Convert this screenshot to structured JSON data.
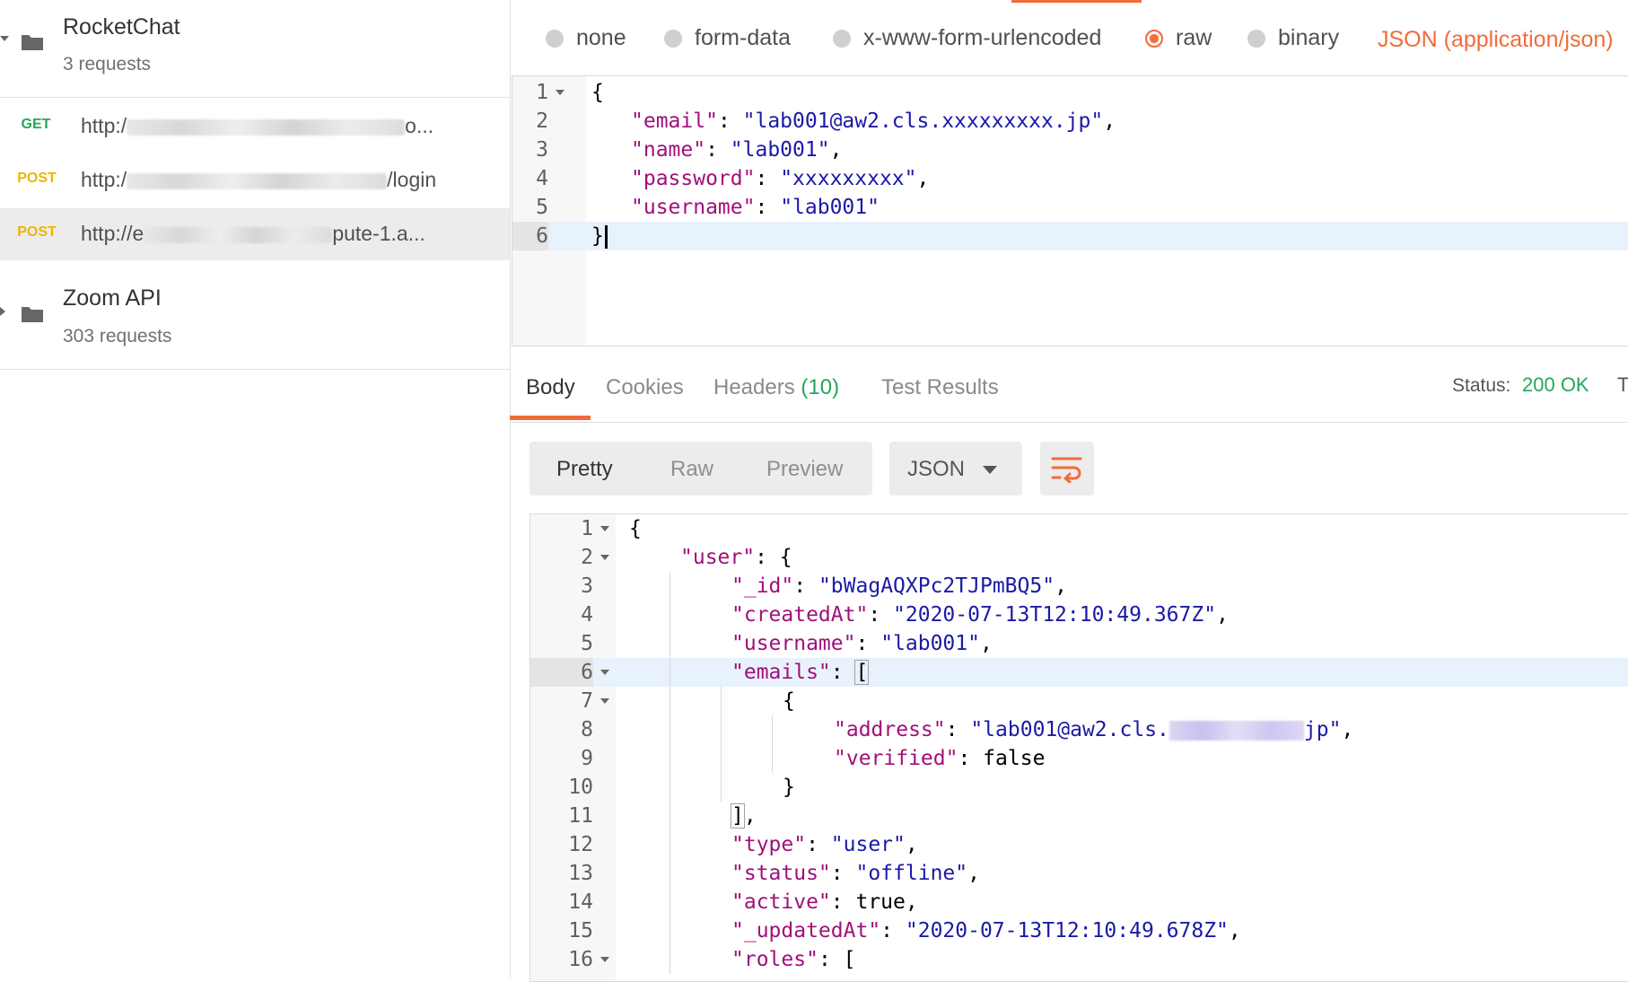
{
  "sidebar": {
    "collections": [
      {
        "name": "RocketChat",
        "count": "3 requests",
        "requests": [
          {
            "method": "GET",
            "url_start": "http:/",
            "url_end": "o..."
          },
          {
            "method": "POST",
            "url_start": "http:/",
            "url_end": "/login"
          },
          {
            "method": "POST",
            "url_start": "http://e",
            "url_end": "pute-1.a..."
          }
        ]
      },
      {
        "name": "Zoom API",
        "count": "303 requests"
      }
    ]
  },
  "body_types": {
    "options": [
      "none",
      "form-data",
      "x-www-form-urlencoded",
      "raw",
      "binary"
    ],
    "selected": "raw",
    "content_type": "JSON (application/json)"
  },
  "request_body": {
    "line_numbers": [
      "1",
      "2",
      "3",
      "4",
      "5",
      "6"
    ],
    "lines": [
      [
        {
          "t": "p",
          "v": "{"
        }
      ],
      [
        {
          "t": "k",
          "v": "\"email\""
        },
        {
          "t": "p",
          "v": ": "
        },
        {
          "t": "s",
          "v": "\"lab001@aw2.cls.xxxxxxxxx.jp\""
        },
        {
          "t": "p",
          "v": ","
        }
      ],
      [
        {
          "t": "k",
          "v": "\"name\""
        },
        {
          "t": "p",
          "v": ": "
        },
        {
          "t": "s",
          "v": "\"lab001\""
        },
        {
          "t": "p",
          "v": ","
        }
      ],
      [
        {
          "t": "k",
          "v": "\"password\""
        },
        {
          "t": "p",
          "v": ": "
        },
        {
          "t": "s",
          "v": "\"xxxxxxxxx\""
        },
        {
          "t": "p",
          "v": ","
        }
      ],
      [
        {
          "t": "k",
          "v": "\"username\""
        },
        {
          "t": "p",
          "v": ": "
        },
        {
          "t": "s",
          "v": "\"lab001\""
        }
      ],
      [
        {
          "t": "p",
          "v": "}"
        }
      ]
    ]
  },
  "response_tabs": {
    "body": "Body",
    "cookies": "Cookies",
    "headers": "Headers",
    "headers_count": "(10)",
    "test_results": "Test Results"
  },
  "status": {
    "label": "Status:",
    "value": "200 OK",
    "extra": "T"
  },
  "view_modes": {
    "pretty": "Pretty",
    "raw": "Raw",
    "preview": "Preview",
    "format": "JSON"
  },
  "response_body": {
    "line_numbers": [
      "1",
      "2",
      "3",
      "4",
      "5",
      "6",
      "7",
      "8",
      "9",
      "10",
      "11",
      "12",
      "13",
      "14",
      "15",
      "16"
    ],
    "lines": [
      [
        {
          "t": "p",
          "v": "{"
        }
      ],
      [
        {
          "t": "k",
          "v": "\"user\""
        },
        {
          "t": "p",
          "v": ": {"
        }
      ],
      [
        {
          "t": "k",
          "v": "\"_id\""
        },
        {
          "t": "p",
          "v": ": "
        },
        {
          "t": "s",
          "v": "\"bWagAQXPc2TJPmBQ5\""
        },
        {
          "t": "p",
          "v": ","
        }
      ],
      [
        {
          "t": "k",
          "v": "\"createdAt\""
        },
        {
          "t": "p",
          "v": ": "
        },
        {
          "t": "s",
          "v": "\"2020-07-13T12:10:49.367Z\""
        },
        {
          "t": "p",
          "v": ","
        }
      ],
      [
        {
          "t": "k",
          "v": "\"username\""
        },
        {
          "t": "p",
          "v": ": "
        },
        {
          "t": "s",
          "v": "\"lab001\""
        },
        {
          "t": "p",
          "v": ","
        }
      ],
      [
        {
          "t": "k",
          "v": "\"emails\""
        },
        {
          "t": "p",
          "v": ": "
        },
        {
          "t": "b",
          "v": "["
        }
      ],
      [
        {
          "t": "p",
          "v": "{"
        }
      ],
      [
        {
          "t": "k",
          "v": "\"address\""
        },
        {
          "t": "p",
          "v": ": "
        },
        {
          "t": "s",
          "v": "\"lab001@aw2.cls."
        },
        {
          "t": "r",
          "v": ""
        },
        {
          "t": "s",
          "v": "jp\""
        },
        {
          "t": "p",
          "v": ","
        }
      ],
      [
        {
          "t": "k",
          "v": "\"verified\""
        },
        {
          "t": "p",
          "v": ": false"
        }
      ],
      [
        {
          "t": "p",
          "v": "}"
        }
      ],
      [
        {
          "t": "b",
          "v": "]"
        },
        {
          "t": "p",
          "v": ","
        }
      ],
      [
        {
          "t": "k",
          "v": "\"type\""
        },
        {
          "t": "p",
          "v": ": "
        },
        {
          "t": "s",
          "v": "\"user\""
        },
        {
          "t": "p",
          "v": ","
        }
      ],
      [
        {
          "t": "k",
          "v": "\"status\""
        },
        {
          "t": "p",
          "v": ": "
        },
        {
          "t": "s",
          "v": "\"offline\""
        },
        {
          "t": "p",
          "v": ","
        }
      ],
      [
        {
          "t": "k",
          "v": "\"active\""
        },
        {
          "t": "p",
          "v": ": true,"
        }
      ],
      [
        {
          "t": "k",
          "v": "\"_updatedAt\""
        },
        {
          "t": "p",
          "v": ": "
        },
        {
          "t": "s",
          "v": "\"2020-07-13T12:10:49.678Z\""
        },
        {
          "t": "p",
          "v": ","
        }
      ],
      [
        {
          "t": "k",
          "v": "\"roles\""
        },
        {
          "t": "p",
          "v": ": ["
        }
      ]
    ]
  },
  "colors": {
    "accent": "#f26b3a",
    "success": "#26a65b",
    "json_key": "#a0107a",
    "json_string": "#1a1aa6"
  }
}
